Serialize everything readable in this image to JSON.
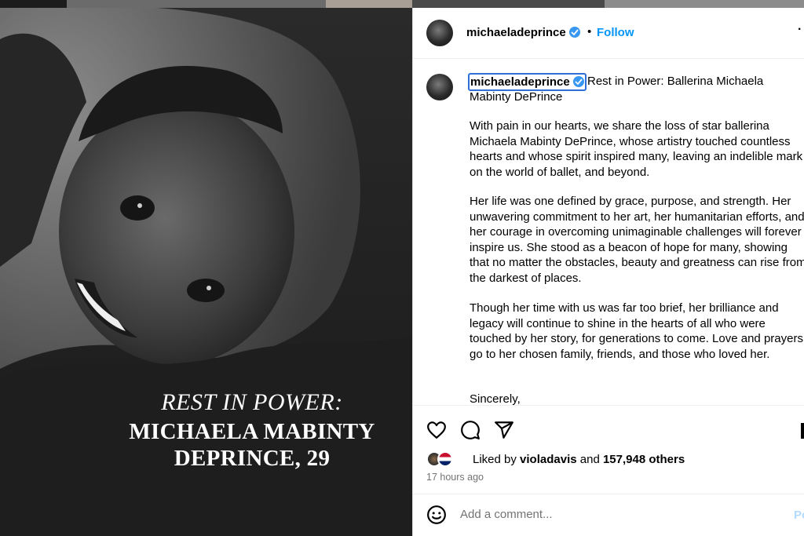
{
  "photo": {
    "overlay_line1": "REST IN POWER:",
    "overlay_line2": "MICHAELA MABINTY",
    "overlay_line3": "DEPRINCE, 29"
  },
  "header": {
    "username": "michaeladeprince",
    "separator": "•",
    "follow_label": "Follow",
    "more_icon": "more-options-icon",
    "more_glyph": "·"
  },
  "caption": {
    "username": "michaeladeprince",
    "title": "Rest in Power: Ballerina Michaela Mabinty DePrince",
    "paragraphs": [
      "With pain in our hearts, we share the loss of star ballerina Michaela Mabinty DePrince, whose artistry touched countless hearts and whose spirit inspired many, leaving an indelible mark on the world of ballet, and beyond.",
      "Her life was one defined by grace, purpose, and strength. Her unwavering commitment to her art, her humanitarian efforts, and her courage in overcoming unimaginable challenges will forever inspire us. She stood as a beacon of hope for many, showing that no matter the obstacles, beauty and greatness can rise from the darkest of places.",
      "Though her time with us was far too brief, her brilliance and legacy will continue to shine in the hearts of all who were touched by her story, for generations to come. Love and prayers go to her chosen family, friends, and those who loved her.",
      "Sincerely,"
    ]
  },
  "actions": {
    "icons": [
      "heart-icon",
      "comment-icon",
      "share-icon",
      "bookmark-icon"
    ]
  },
  "likes": {
    "prefix": "Liked by ",
    "user": "violadavis",
    "middle": " and ",
    "count": "157,948 others"
  },
  "timestamp": "17 hours ago",
  "comment": {
    "placeholder": "Add a comment...",
    "post_label": "Po"
  },
  "colors": {
    "accent": "#0095f6",
    "verified": "#3897f0",
    "muted": "#737373",
    "post_disabled": "#b3dbff",
    "focus_outline": "#2f6fd8"
  }
}
